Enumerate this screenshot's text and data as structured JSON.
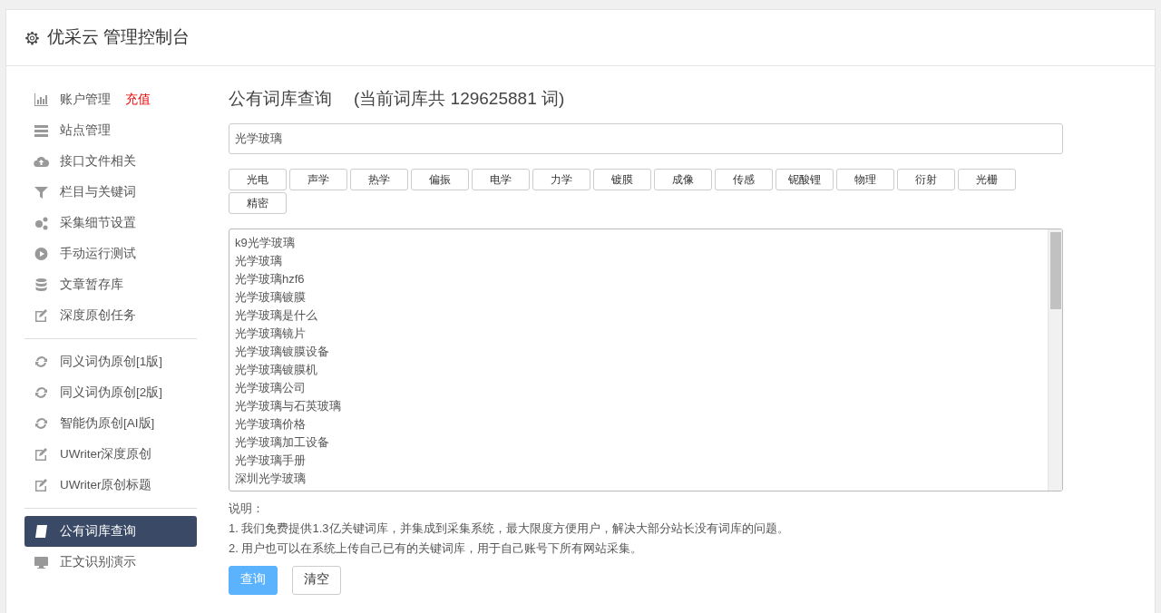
{
  "header": {
    "title": "优采云 管理控制台"
  },
  "sidebar": {
    "groups": [
      [
        {
          "label": "账户管理",
          "tag": "充值",
          "selected": false
        },
        {
          "label": "站点管理",
          "selected": false
        },
        {
          "label": "接口文件相关",
          "selected": false
        },
        {
          "label": "栏目与关键词",
          "selected": false
        },
        {
          "label": "采集细节设置",
          "selected": false
        },
        {
          "label": "手动运行测试",
          "selected": false
        },
        {
          "label": "文章暂存库",
          "selected": false
        },
        {
          "label": "深度原创任务",
          "selected": false
        }
      ],
      [
        {
          "label": "同义词伪原创[1版]",
          "selected": false
        },
        {
          "label": "同义词伪原创[2版]",
          "selected": false
        },
        {
          "label": "智能伪原创[AI版]",
          "selected": false
        },
        {
          "label": "UWriter深度原创",
          "selected": false
        },
        {
          "label": "UWriter原创标题",
          "selected": false
        }
      ],
      [
        {
          "label": "公有词库查询",
          "selected": true
        },
        {
          "label": "正文识别演示",
          "selected": false
        }
      ]
    ]
  },
  "main": {
    "title": "公有词库查询",
    "count_note": "(当前词库共 129625881 词)",
    "search": {
      "value": "光学玻璃"
    },
    "tags": [
      "光电",
      "声学",
      "热学",
      "偏振",
      "电学",
      "力学",
      "镀膜",
      "成像",
      "传感",
      "铌酸锂",
      "物理",
      "衍射",
      "光栅",
      "精密"
    ],
    "results": [
      "k9光学玻璃",
      "光学玻璃",
      "光学玻璃hzf6",
      "光学玻璃镀膜",
      "光学玻璃是什么",
      "光学玻璃镜片",
      "光学玻璃镀膜设备",
      "光学玻璃镀膜机",
      "光学玻璃公司",
      "光学玻璃与石英玻璃",
      "光学玻璃价格",
      "光学玻璃加工设备",
      "光学玻璃手册",
      "深圳光学玻璃"
    ],
    "notes_label": "说明：",
    "notes": [
      "1. 我们免费提供1.3亿关键词库，并集成到采集系统，最大限度方便用户，解决大部分站长没有词库的问题。",
      "2. 用户也可以在系统上传自己已有的关键词库，用于自己账号下所有网站采集。"
    ],
    "buttons": [
      {
        "label": "查询",
        "kind": "primary"
      },
      {
        "label": "清空",
        "kind": "default"
      }
    ]
  }
}
